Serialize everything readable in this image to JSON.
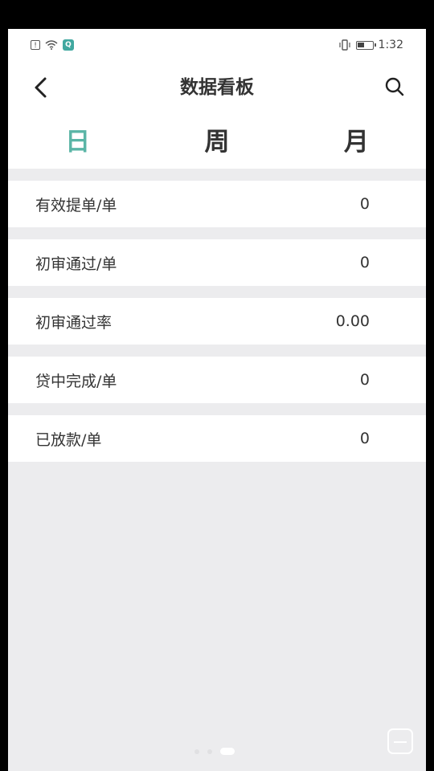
{
  "statusbar": {
    "time": "1:32",
    "notification_icon": "sim-alert-icon",
    "app_icon": "app-notification-icon"
  },
  "header": {
    "title": "数据看板",
    "back_icon": "chevron-left-icon",
    "search_icon": "search-icon"
  },
  "tabs": [
    {
      "label": "日",
      "active": true
    },
    {
      "label": "周",
      "active": false
    },
    {
      "label": "月",
      "active": false
    }
  ],
  "stats": [
    {
      "label": "有效提单/单",
      "value": "0"
    },
    {
      "label": "初审通过/单",
      "value": "0"
    },
    {
      "label": "初审通过率",
      "value": "0.00"
    },
    {
      "label": "贷中完成/单",
      "value": "0"
    },
    {
      "label": "已放款/单",
      "value": "0"
    }
  ],
  "colors": {
    "accent": "#5ab5a6",
    "background": "#ececee",
    "text": "#333333"
  }
}
